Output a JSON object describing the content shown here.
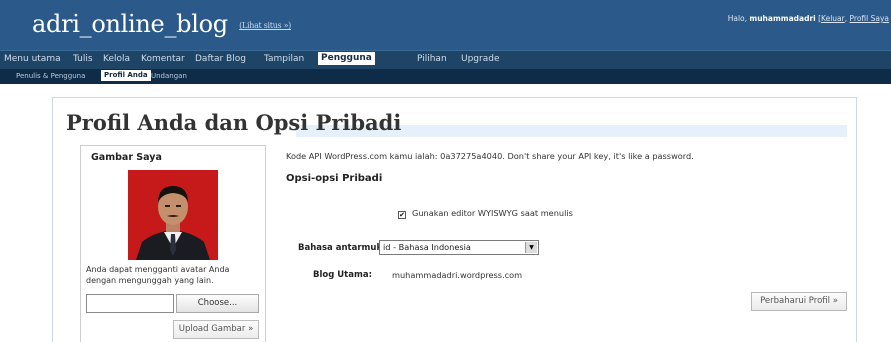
{
  "header": {
    "blog_title": "adri_online_blog",
    "view_site": "(Lihat situs »)",
    "greeting": "Halo, ",
    "username": "muhammadadri",
    "open_paren": " [",
    "logout": "Keluar",
    "separator": ", ",
    "profile": "Profil Saya"
  },
  "main_nav": {
    "items": [
      "Menu utama",
      "Tulis",
      "Kelola",
      "Komentar",
      "Daftar Blog",
      "Tampilan",
      "Pengguna",
      "Pilihan",
      "Upgrade"
    ],
    "active": "Pengguna"
  },
  "sub_nav": {
    "items": [
      "Penulis & Pengguna",
      "Profil Anda",
      "Undangan"
    ],
    "active": "Profil Anda"
  },
  "page": {
    "title": "Profil Anda dan Opsi Pribadi"
  },
  "avatar": {
    "title": "Gambar Saya",
    "text_line1": "Anda dapat mengganti avatar Anda",
    "text_line2": "dengan mengunggah yang lain.",
    "file_value": "",
    "choose_label": "Choose...",
    "upload_label": "Upload Gambar »"
  },
  "options": {
    "api_note": "Kode API WordPress.com kamu ialah: 0a37275a4040. Don't share your API key, it's like a password.",
    "section_title": "Opsi-opsi Pribadi",
    "wysiwyg_label": "Gunakan editor WYISWYG saat menulis",
    "wysiwyg_checked": true,
    "check_mark": "✔",
    "language_label": "Bahasa antarmuka",
    "language_value": "id - Bahasa Indonesia",
    "blog_label": "Blog Utama:",
    "blog_value": "muhammadadri.wordpress.com",
    "update_label": "Perbaharui Profil »"
  },
  "icons": {
    "select_arrow": "chevron-down-icon",
    "checkbox": "checkbox-icon"
  },
  "colors": {
    "header_bg": "#2b5a8a",
    "main_nav_bg": "#1e4566",
    "sub_nav_bg": "#0e2c48",
    "avatar_bg": "#c61a1a",
    "title_bar_bg": "#e6f0fa"
  }
}
